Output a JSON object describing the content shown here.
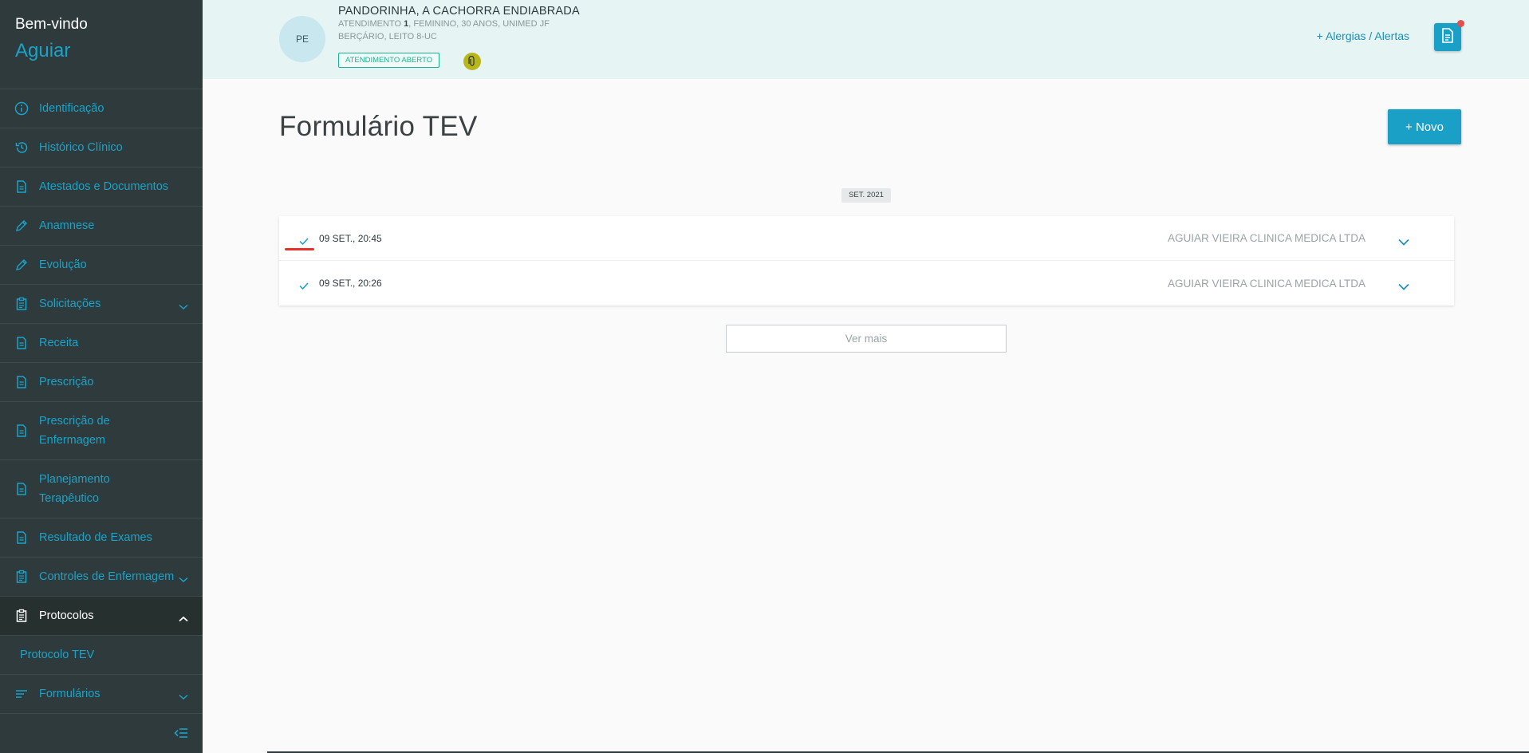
{
  "sidebar": {
    "welcome": "Bem-vindo",
    "user": "Aguiar",
    "items": [
      {
        "label": "Identificação",
        "icon": "info-icon"
      },
      {
        "label": "Histórico Clínico",
        "icon": "history-icon"
      },
      {
        "label": "Atestados e Documentos",
        "icon": "document-icon"
      },
      {
        "label": "Anamnese",
        "icon": "pencil-icon"
      },
      {
        "label": "Evolução",
        "icon": "pencil-icon"
      },
      {
        "label": "Solicitações",
        "icon": "clipboard-icon"
      },
      {
        "label": "Receita",
        "icon": "document-icon"
      },
      {
        "label": "Prescrição",
        "icon": "document-icon"
      },
      {
        "label": "Prescrição de Enfermagem",
        "icon": "document-icon"
      },
      {
        "label": "Planejamento Terapêutico",
        "icon": "document-icon"
      },
      {
        "label": "Resultado de Exames",
        "icon": "document-icon"
      },
      {
        "label": "Controles de Enfermagem",
        "icon": "clipboard-icon"
      },
      {
        "label": "Protocolos",
        "icon": "clipboard-icon"
      },
      {
        "label": "Formulários",
        "icon": "list-icon"
      }
    ],
    "sub_item": "Protocolo TEV"
  },
  "header": {
    "avatar_initials": "PE",
    "patient_name": "PANDORINHA, A CACHORRA ENDIABRADA",
    "info_prefix": "ATENDIMENTO ",
    "info_number": "1",
    "info_rest": ", FEMININO, 30 ANOS, UNIMED JF",
    "location": "BERÇÁRIO, LEITO 8-UC",
    "status_badge": "ATENDIMENTO ABERTO",
    "alergias": "+  Alergias / Alertas"
  },
  "main": {
    "title": "Formulário TEV",
    "new_button": "+ Novo",
    "month_chip": "SET. 2021",
    "rows": [
      {
        "when": "09 SET., 20:45",
        "org": "AGUIAR VIEIRA CLINICA MEDICA LTDA"
      },
      {
        "when": "09 SET., 20:26",
        "org": "AGUIAR VIEIRA CLINICA MEDICA LTDA"
      }
    ],
    "ver_mais": "Ver mais"
  },
  "colors": {
    "accent": "#1a9fc7",
    "sidebar_bg": "#2f3a3c",
    "header_bg": "#e6f4f4",
    "status_green": "#19b394",
    "alert_red": "#e84c4c"
  }
}
